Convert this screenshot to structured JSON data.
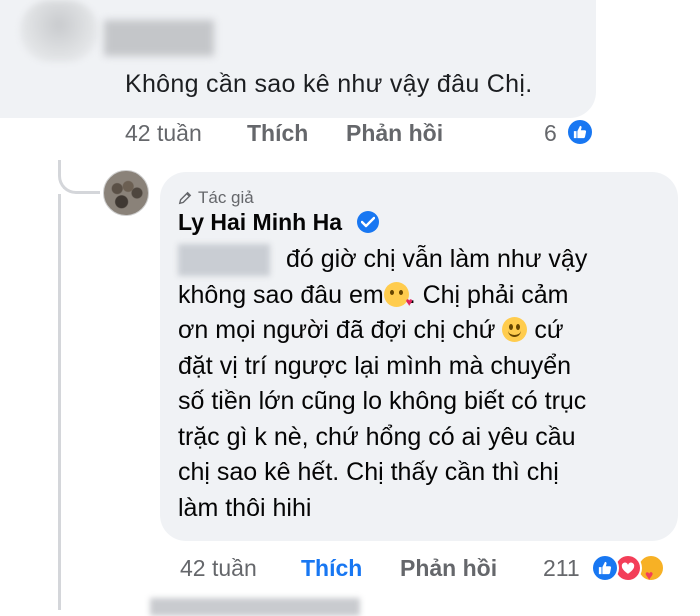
{
  "comment1": {
    "text": "Không cần sao kê như vậy đâu Chị.",
    "time": "42 tuần",
    "like_label": "Thích",
    "reply_label": "Phản hồi",
    "reaction_count": "6"
  },
  "reply": {
    "author_tag": "Tác giả",
    "author_name": "Ly Hai Minh Ha",
    "lines": [
      "đó giờ chị vẫn làm như vậy",
      "không sao đâu em",
      ". Chị phải cảm",
      "ơn mọi người đã đợi chị chứ",
      "cứ",
      "đặt vị trí ngược lại mình mà chuyển",
      "số tiền lớn cũng lo không biết có trục",
      "trặc gì k nè, chứ hổng có ai yêu cầu",
      "chị sao kê hết. Chị thấy cần thì chị",
      "làm thôi hihi"
    ],
    "time": "42 tuần",
    "like_label": "Thích",
    "reply_label": "Phản hồi",
    "reaction_count": "211"
  },
  "colors": {
    "bubble": "#f0f2f5",
    "meta_text": "#65676b",
    "facebook_blue": "#1877f2",
    "love_red": "#f33e58",
    "care_yellow": "#f7b125"
  },
  "icons": [
    "like-icon",
    "love-icon",
    "care-icon",
    "verified-badge-icon",
    "author-pen-icon",
    "kiss-emoji-icon",
    "smile-emoji-icon"
  ]
}
